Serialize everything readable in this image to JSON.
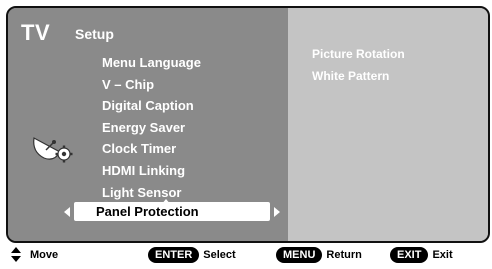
{
  "header": {
    "tv_label": "TV",
    "section_label": "Setup"
  },
  "menu": {
    "items": [
      "Menu Language",
      "V – Chip",
      "Digital Caption",
      "Energy Saver",
      "Clock Timer",
      "HDMI Linking",
      "Light Sensor"
    ],
    "selected": "Panel Protection"
  },
  "submenu": {
    "items": [
      "Picture Rotation",
      "White Pattern"
    ]
  },
  "footer": {
    "move_label": "Move",
    "enter_key": "ENTER",
    "select_label": "Select",
    "menu_key": "MENU",
    "return_label": "Return",
    "exit_key": "EXIT",
    "exit_label": "Exit"
  },
  "icons": {
    "setup_icon": "satellite-dish-with-gear-icon",
    "scroll_up_icon": "triangle-up-icon",
    "left_arrow_icon": "triangle-left-icon",
    "right_arrow_icon": "triangle-right-icon",
    "move_icon": "up-down-arrows-icon"
  },
  "colors": {
    "left_pane": "#8a8a8a",
    "right_pane": "#c4c4c4",
    "highlight": "#ffffff",
    "key_background": "#000000"
  }
}
